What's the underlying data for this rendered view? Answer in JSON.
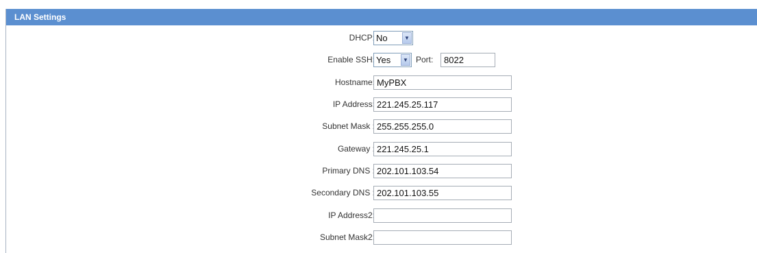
{
  "panel": {
    "title": "LAN Settings"
  },
  "dhcp": {
    "label": "DHCP:",
    "value": "No"
  },
  "ssh": {
    "label": "Enable SSH:",
    "value": "Yes",
    "port_label": "Port:",
    "port_value": "8022"
  },
  "hostname": {
    "label": "Hostname:",
    "value": "MyPBX"
  },
  "ip_address": {
    "label": "IP Address:",
    "value": "221.245.25.117"
  },
  "subnet_mask": {
    "label": "Subnet Mask :",
    "value": "255.255.255.0"
  },
  "gateway": {
    "label": "Gateway :",
    "value": "221.245.25.1"
  },
  "primary_dns": {
    "label": "Primary DNS :",
    "value": "202.101.103.54"
  },
  "secondary_dns": {
    "label": "Secondary DNS :",
    "value": "202.101.103.55"
  },
  "ip_address2": {
    "label": "IP Address2:",
    "value": ""
  },
  "subnet_mask2": {
    "label": "Subnet Mask2:",
    "value": ""
  },
  "colors": {
    "header_bg": "#5b8fd0",
    "header_text": "#ffffff"
  }
}
